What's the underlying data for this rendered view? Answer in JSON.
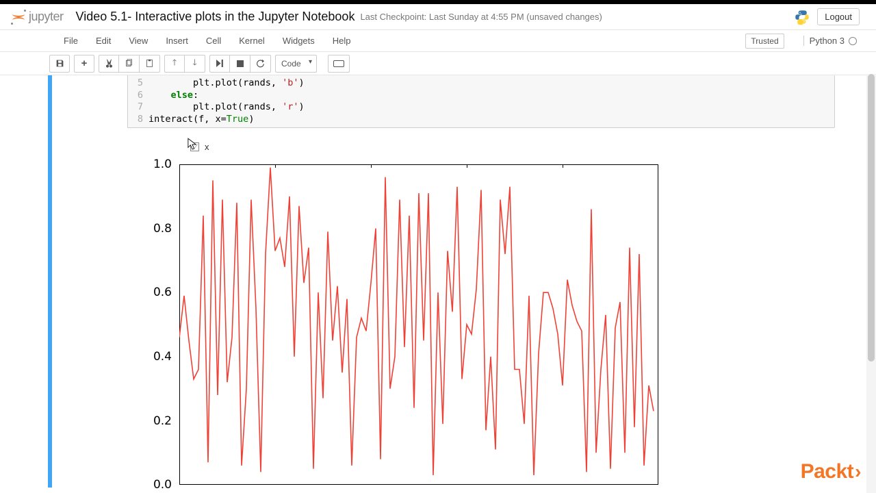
{
  "header": {
    "logo_text": "jupyter",
    "title": "Video 5.1- Interactive plots in the Jupyter Notebook",
    "checkpoint": "Last Checkpoint: Last Sunday at 4:55 PM (unsaved changes)",
    "logout": "Logout"
  },
  "menu": {
    "items": [
      "File",
      "Edit",
      "View",
      "Insert",
      "Cell",
      "Kernel",
      "Widgets",
      "Help"
    ],
    "trusted": "Trusted",
    "kernel": "Python 3"
  },
  "toolbar": {
    "celltype_value": "Code"
  },
  "code": {
    "lines": [
      {
        "n": "5",
        "indent": "        ",
        "tokens": [
          {
            "t": "plt.plot(rands, "
          },
          {
            "t": "'b'",
            "c": "str"
          },
          {
            "t": ")"
          }
        ]
      },
      {
        "n": "6",
        "indent": "    ",
        "tokens": [
          {
            "t": "else",
            "c": "kw"
          },
          {
            "t": ":"
          }
        ]
      },
      {
        "n": "7",
        "indent": "        ",
        "tokens": [
          {
            "t": "plt.plot(rands, "
          },
          {
            "t": "'r'",
            "c": "str"
          },
          {
            "t": ")"
          }
        ]
      },
      {
        "n": "8",
        "indent": "",
        "tokens": [
          {
            "t": "interact(f, x="
          },
          {
            "t": "True",
            "c": "nm"
          },
          {
            "t": ")"
          }
        ]
      }
    ]
  },
  "widget": {
    "label": "x",
    "checked": false
  },
  "chart_data": {
    "type": "line",
    "title": "",
    "xlabel": "",
    "ylabel": "",
    "xlim": [
      0,
      100
    ],
    "ylim": [
      0,
      1.0
    ],
    "yticks": [
      0.0,
      0.2,
      0.4,
      0.6,
      0.8,
      1.0
    ],
    "xticks_top": [
      0,
      20,
      40,
      60,
      80
    ],
    "color": "#ef4135",
    "x": [
      0,
      1,
      2,
      3,
      4,
      5,
      6,
      7,
      8,
      9,
      10,
      11,
      12,
      13,
      14,
      15,
      16,
      17,
      18,
      19,
      20,
      21,
      22,
      23,
      24,
      25,
      26,
      27,
      28,
      29,
      30,
      31,
      32,
      33,
      34,
      35,
      36,
      37,
      38,
      39,
      40,
      41,
      42,
      43,
      44,
      45,
      46,
      47,
      48,
      49,
      50,
      51,
      52,
      53,
      54,
      55,
      56,
      57,
      58,
      59,
      60,
      61,
      62,
      63,
      64,
      65,
      66,
      67,
      68,
      69,
      70,
      71,
      72,
      73,
      74,
      75,
      76,
      77,
      78,
      79,
      80,
      81,
      82,
      83,
      84,
      85,
      86,
      87,
      88,
      89,
      90,
      91,
      92,
      93,
      94,
      95,
      96,
      97,
      98,
      99
    ],
    "values": [
      0.46,
      0.59,
      0.45,
      0.33,
      0.36,
      0.84,
      0.07,
      0.95,
      0.28,
      0.89,
      0.32,
      0.46,
      0.88,
      0.06,
      0.3,
      0.89,
      0.55,
      0.04,
      0.72,
      0.99,
      0.73,
      0.77,
      0.68,
      0.9,
      0.4,
      0.87,
      0.63,
      0.74,
      0.05,
      0.6,
      0.27,
      0.79,
      0.45,
      0.62,
      0.35,
      0.58,
      0.06,
      0.46,
      0.52,
      0.48,
      0.63,
      0.8,
      0.08,
      0.96,
      0.3,
      0.4,
      0.89,
      0.43,
      0.84,
      0.24,
      0.91,
      0.45,
      0.91,
      0.03,
      0.6,
      0.19,
      0.73,
      0.54,
      0.93,
      0.33,
      0.5,
      0.47,
      0.61,
      0.92,
      0.17,
      0.4,
      0.11,
      0.89,
      0.72,
      0.93,
      0.36,
      0.36,
      0.19,
      0.59,
      0.03,
      0.41,
      0.6,
      0.6,
      0.55,
      0.47,
      0.31,
      0.64,
      0.56,
      0.51,
      0.48,
      0.04,
      0.86,
      0.1,
      0.36,
      0.53,
      0.05,
      0.49,
      0.57,
      0.1,
      0.74,
      0.18,
      0.72,
      0.06,
      0.31,
      0.23
    ]
  },
  "branding": {
    "packt": "Packt"
  }
}
